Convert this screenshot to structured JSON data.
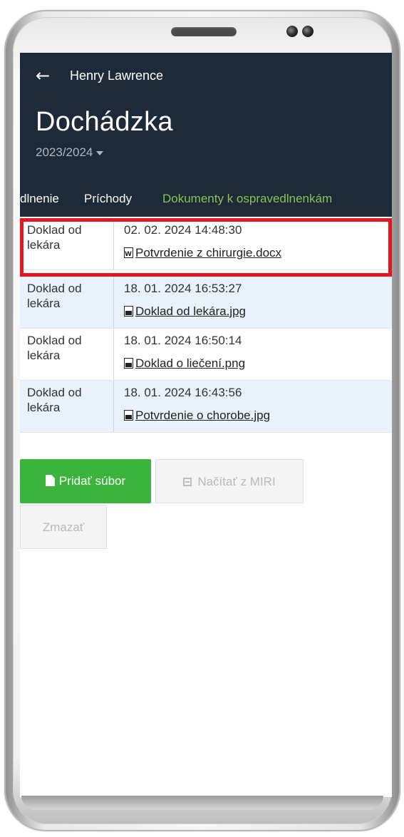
{
  "header": {
    "back_icon": "arrow-left-icon",
    "user_name": "Henry Lawrence",
    "title": "Dochádzka",
    "school_year": "2023/2024"
  },
  "tabs": [
    {
      "label": "dlnenie",
      "active": false
    },
    {
      "label": "Príchody",
      "active": false
    },
    {
      "label": "Dokumenty k ospravedlnenkám",
      "active": true
    }
  ],
  "documents": [
    {
      "type": "Doklad od lekára",
      "datetime": "02. 02. 2024 14:48:30",
      "file": "Potvrdenie z chirurgie.docx",
      "file_icon": "word-file-icon",
      "highlighted": true
    },
    {
      "type": "Doklad od lekára",
      "datetime": "18. 01. 2024 16:53:27",
      "file": "Doklad od lekára.jpg",
      "file_icon": "image-file-icon",
      "highlighted": false
    },
    {
      "type": "Doklad od lekára",
      "datetime": "18. 01. 2024 16:50:14",
      "file": "Doklad o liečení.png",
      "file_icon": "image-file-icon",
      "highlighted": false
    },
    {
      "type": "Doklad od lekára",
      "datetime": "18. 01. 2024 16:43:56",
      "file": "Potvrdenie o chorobe.jpg",
      "file_icon": "image-file-icon",
      "highlighted": false
    }
  ],
  "actions": {
    "add_file": "Pridať súbor",
    "load_miri": "Načítať z MIRI",
    "delete": "Zmazať"
  },
  "colors": {
    "header_bg": "#1d2a3a",
    "active_tab": "#8bc34a",
    "add_button": "#3cb43c",
    "highlight_border": "#e3161f",
    "alt_row": "#e9f2fb"
  }
}
